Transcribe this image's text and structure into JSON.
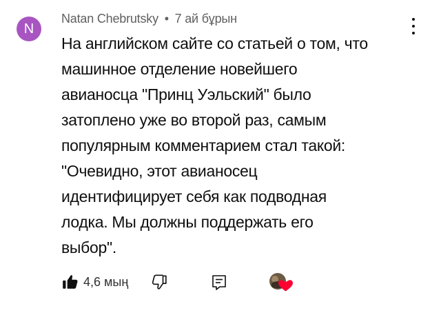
{
  "comment": {
    "avatar_letter": "N",
    "author": "Natan Chebrutsky",
    "separator": "•",
    "time": "7 ай бұрын",
    "text_lines": [
      "На английском сайте со статьей о том, что",
      "машинное отделение новейшего",
      "авианосца \"Принц Уэльский\" было",
      "затоплено уже во второй раз, самым",
      "популярным комментарием стал такой:",
      "\"Очевидно, этот авианосец",
      "идентифицирует себя как подводная",
      "лодка. Мы должны поддержать его",
      "выбор\"."
    ]
  },
  "actions": {
    "like_count": "4,6 мың",
    "icons": {
      "like": "thumbs-up-filled-icon",
      "dislike": "thumbs-down-outline-icon",
      "reply": "reply-icon",
      "creator_heart": "creator-heart-icon",
      "menu": "more-vertical-icon"
    }
  },
  "colors": {
    "avatar_bg": "#a855c2",
    "text": "#0f0f0f",
    "meta": "#606060",
    "heart": "#ff0033"
  }
}
